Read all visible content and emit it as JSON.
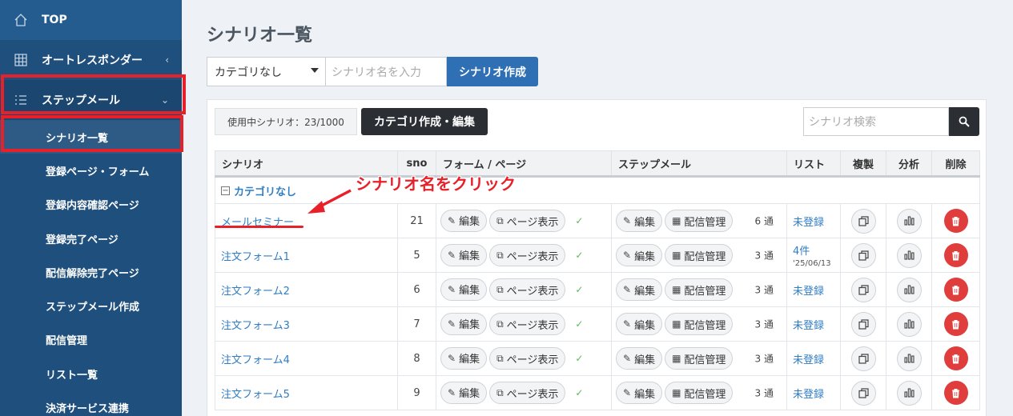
{
  "sidebar": {
    "top_label": "TOP",
    "autoresponder_label": "オートレスポンダー",
    "stepmail_label": "ステップメール",
    "sub_items": [
      "シナリオ一覧",
      "登録ページ・フォーム",
      "登録内容確認ページ",
      "登録完了ページ",
      "配信解除完了ページ",
      "ステップメール作成",
      "配信管理",
      "リスト一覧",
      "決済サービス連携"
    ]
  },
  "main": {
    "title": "シナリオ一覧",
    "category_select": "カテゴリなし",
    "name_placeholder": "シナリオ名を入力",
    "create_button": "シナリオ作成",
    "usage_text": "使用中シナリオ：23/1000",
    "category_button": "カテゴリ作成・編集",
    "search_placeholder": "シナリオ検索"
  },
  "table": {
    "headers": {
      "scenario": "シナリオ",
      "sno": "sno",
      "form": "フォーム / ページ",
      "step": "ステップメール",
      "list": "リスト",
      "copy": "複製",
      "analyze": "分析",
      "delete": "削除"
    },
    "category": "カテゴリなし",
    "edit_label": "編集",
    "page_view_label": "ページ表示",
    "delivery_label": "配信管理",
    "rows": [
      {
        "name": "メールセミナー",
        "sno": "21",
        "count": "6 通",
        "list": "未登録",
        "date": ""
      },
      {
        "name": "注文フォーム1",
        "sno": "5",
        "count": "3 通",
        "list": "4件",
        "date": "'25/06/13"
      },
      {
        "name": "注文フォーム2",
        "sno": "6",
        "count": "3 通",
        "list": "未登録",
        "date": ""
      },
      {
        "name": "注文フォーム3",
        "sno": "7",
        "count": "3 通",
        "list": "未登録",
        "date": ""
      },
      {
        "name": "注文フォーム4",
        "sno": "8",
        "count": "3 通",
        "list": "未登録",
        "date": ""
      },
      {
        "name": "注文フォーム5",
        "sno": "9",
        "count": "3 通",
        "list": "未登録",
        "date": ""
      }
    ]
  },
  "annotation": {
    "text": "シナリオ名をクリック",
    "color": "#e8202a"
  },
  "colors": {
    "sidebar": "#1f4f7d",
    "primary": "#2f6fb4",
    "link": "#2f7dc5",
    "delete": "#e03d3d"
  }
}
